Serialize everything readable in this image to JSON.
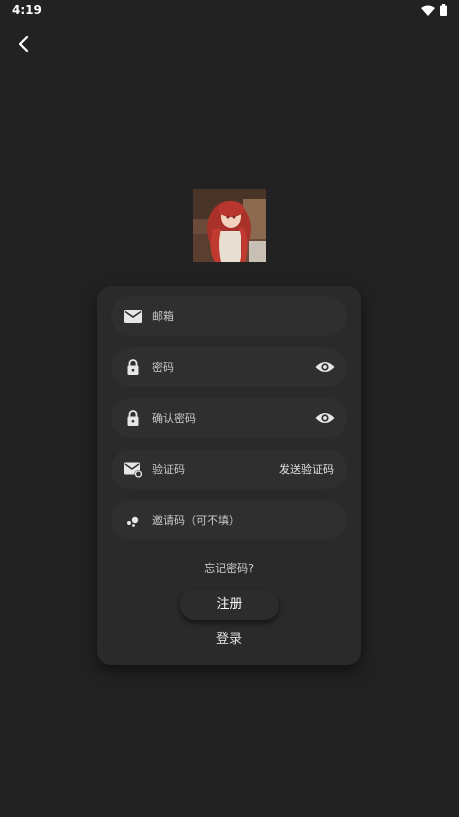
{
  "status_bar": {
    "time": "4:19",
    "wifi_icon": "wifi-icon",
    "battery_icon": "battery-icon"
  },
  "nav": {
    "back_icon": "chevron-left-icon"
  },
  "avatar": {
    "icon": "anime-girl-avatar"
  },
  "form": {
    "email_placeholder": "邮箱",
    "password_placeholder": "密码",
    "confirm_password_placeholder": "确认密码",
    "code_placeholder": "验证码",
    "send_code_label": "发送验证码",
    "invite_placeholder": "邀请码（可不填）",
    "forgot_password_label": "忘记密码?",
    "register_label": "注册",
    "login_label": "登录"
  },
  "colors": {
    "background": "#222222",
    "card": "#2a2a2a",
    "field": "#2f2f2f",
    "icon": "#e6e6e6"
  }
}
